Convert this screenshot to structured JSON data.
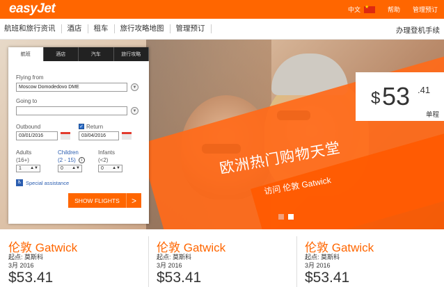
{
  "header": {
    "logo": "easyJet",
    "language": "中文",
    "help": "帮助",
    "manage_booking": "管理预订"
  },
  "nav": {
    "items": [
      "航班和旅行资讯",
      "酒店",
      "租车",
      "旅行攻略地图",
      "管理预订"
    ],
    "right": "办理登机手续"
  },
  "hero": {
    "title": "欧洲热门购物天堂",
    "subtitle": "访问 伦敦 Gatwick",
    "price_dollar": "$",
    "price_main": "53",
    "price_cents": ".41",
    "price_label": "单程"
  },
  "search": {
    "tabs": [
      "航班",
      "酒店",
      "汽车",
      "旅行攻略"
    ],
    "flying_from_label": "Flying from",
    "flying_from_value": "Moscow Domodedovo DME",
    "going_to_label": "Going to",
    "going_to_value": "",
    "outbound_label": "Outbound",
    "outbound_value": "03/01/2016",
    "return_label": "Return",
    "return_value": "03/04/2016",
    "adults_label": "Adults",
    "adults_range": "(16+)",
    "adults_value": "1",
    "children_label": "Children",
    "children_range": "(2 - 15)",
    "children_value": "0",
    "infants_label": "Infants",
    "infants_range": "(<2)",
    "infants_value": "0",
    "special_assistance": "Special assistance",
    "show_flights": "SHOW FLIGHTS",
    "go": ">"
  },
  "deals": [
    {
      "city": "伦敦 Gatwick",
      "from": "起点: 莫斯科",
      "date": "3月 2016",
      "price": "$53.41"
    },
    {
      "city": "伦敦 Gatwick",
      "from": "起点: 莫斯科",
      "date": "3月 2016",
      "price": "$53.41"
    },
    {
      "city": "伦敦 Gatwick",
      "from": "起点: 莫斯科",
      "date": "3月 2016",
      "price": "$53.41"
    }
  ],
  "colors": {
    "brand": "#ff6600",
    "link": "#2a5db0"
  }
}
